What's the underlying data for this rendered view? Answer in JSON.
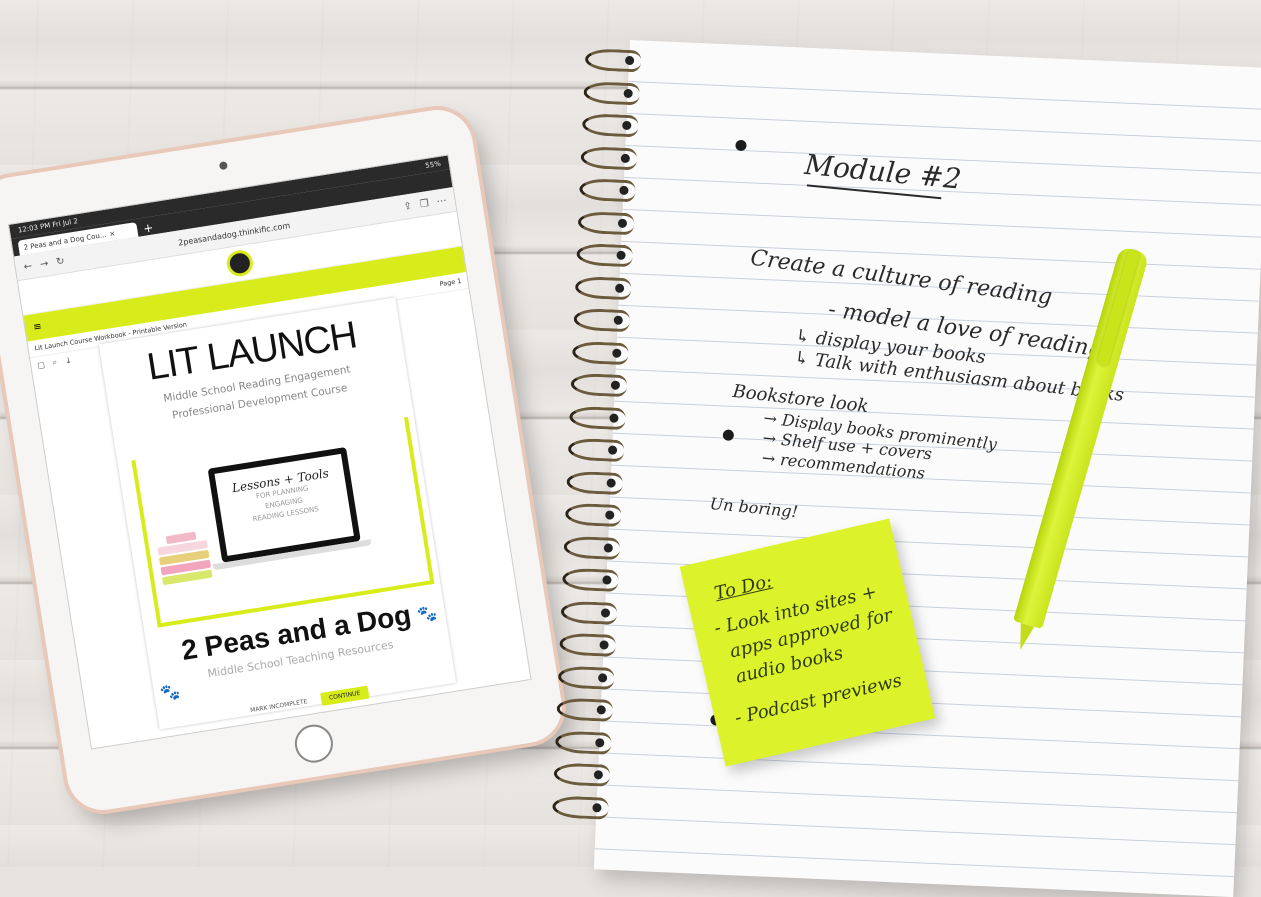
{
  "tablet": {
    "status_time": "12:03 PM  Fri Jul 2",
    "status_battery": "55%",
    "tab_title": "2 Peas and a Dog Cou...",
    "url": "2peasandadog.thinkific.com",
    "doc_title": "Lit Launch Course Workbook - Printable Version",
    "page_indicator": "Page 1",
    "page_title": "LIT LAUNCH",
    "page_subtitle_1": "Middle School Reading Engagement",
    "page_subtitle_2": "Professional Development Course",
    "laptop_line_1": "Lessons + Tools",
    "laptop_line_2": "FOR PLANNING",
    "laptop_line_3": "ENGAGING",
    "laptop_line_4": "READING LESSONS",
    "brand": "2 Peas and a Dog",
    "brand_sub": "Middle School Teaching Resources",
    "mark_complete": "MARK INCOMPLETE",
    "continue": "CONTINUE"
  },
  "notebook": {
    "title": "Module #2",
    "lines": [
      "Create a culture of reading",
      "- model a love of reading",
      "↳ display your books",
      "↳ Talk with enthusiasm about books",
      "Bookstore look",
      "→ Display books prominently",
      "→ Shelf use + covers",
      "→ recommendations",
      "Un boring!"
    ]
  },
  "sticky_note": {
    "title": "To Do:",
    "lines": [
      "- Look into sites +",
      "apps approved for",
      "audio books",
      "- Podcast previews"
    ]
  },
  "colors": {
    "accent_lime": "#d7ec1a",
    "wood": "#e7e3e0",
    "ink": "#2a2a2a"
  }
}
